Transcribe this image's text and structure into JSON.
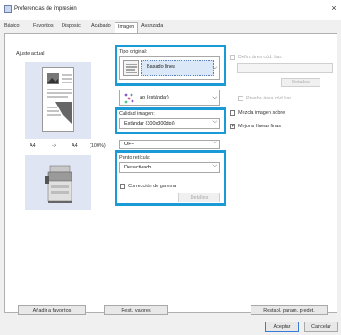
{
  "window": {
    "title": "Preferencias de impresión",
    "close_symbol": "×"
  },
  "tabs": [
    "Básico",
    "Favoritos",
    "Disposic.",
    "Acabado",
    "Imagen",
    "Avanzada"
  ],
  "current_settings": {
    "label": "Ajuste actual",
    "size_from": "A4",
    "arrow": "->",
    "size_to": "A4",
    "zoom": "(100%)"
  },
  "original_type": {
    "label": "Tipo original:",
    "value": "Basado línea"
  },
  "hidden_field": {
    "value": "ao (estándar)"
  },
  "image_quality": {
    "label": "Calidad imagen:",
    "value": "Estándar (300x300dpi)"
  },
  "off_combo": {
    "value": "OFF"
  },
  "screening": {
    "label": "Punto retícula:",
    "value": "Desactivado",
    "gamma_checkbox": "Corrección de gamma",
    "details_button": "Detalles"
  },
  "right_options": {
    "barcode_area": "Defin. área cód. bar.",
    "details_button": "Detalles",
    "test_barcode": "Prueba área cód.bar",
    "image_on_top": "Mezcla imagen sobre",
    "improve_lines": "Mejorar líneas finas",
    "improve_lines_checked": true
  },
  "footer": {
    "add_favorites": "Añadir a favoritos",
    "restore_values": "Resti. valores",
    "restore_defaults": "Restabl. param. predet.",
    "accept": "Aceptar",
    "cancel": "Cancelar"
  }
}
